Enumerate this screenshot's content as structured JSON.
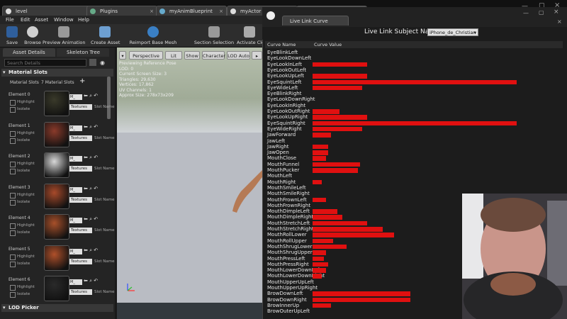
{
  "tabs": [
    {
      "label": "level",
      "active": false
    },
    {
      "label": "Plugins",
      "active": false
    },
    {
      "label": "myAnimBlueprint",
      "active": false
    },
    {
      "label": "myActor",
      "active": false
    },
    {
      "label": "",
      "active": true
    }
  ],
  "menu": [
    "File",
    "Edit",
    "Asset",
    "Window",
    "Help"
  ],
  "toolbar": {
    "save": "Save",
    "browse": "Browse",
    "preview_animation": "Preview Animation",
    "create_asset": "Create Asset",
    "reimport": "Reimport Base Mesh",
    "section_selection": "Section Selection",
    "activate_cloth": "Activate Clo"
  },
  "left_panel": {
    "tab_asset_details": "Asset Details",
    "tab_skeleton_tree": "Skeleton Tree",
    "search_placeholder": "Search Details",
    "material_slots_header": "Material Slots",
    "material_slots_label": "Material Slots",
    "material_slots_count": "7 Material Slots",
    "highlight": "Highlight",
    "isolate": "Isolate",
    "textures": "Textures",
    "slot_name": "Slot Name",
    "mat_short": "M_",
    "elements": [
      "Element 0",
      "Element 1",
      "Element 2",
      "Element 3",
      "Element 4",
      "Element 5",
      "Element 6"
    ],
    "lod_picker": "LOD Picker"
  },
  "viewport": {
    "perspective": "Perspective",
    "lit": "Lit",
    "show": "Show",
    "character": "Character",
    "lod_auto": "LOD Auto",
    "info": [
      "Previewing Reference Pose",
      "LOD: 0",
      "Current Screen Size: 3",
      "Triangles: 29,630",
      "Vertices: 17,862",
      "UV Channels: 1",
      "Approx Size: 278x73x209"
    ]
  },
  "live_link": {
    "tab_title": "Live Link Curve Debugger",
    "subject_label": "Live Link Subject Name:",
    "subject_value": "iPhone_de_Christian",
    "col_name": "Curve Name",
    "col_value": "Curve Value",
    "curves": [
      {
        "name": "EyeBlinkLeft",
        "value": 0
      },
      {
        "name": "EyeLookDownLeft",
        "value": 0
      },
      {
        "name": "EyeLookInLeft",
        "value": 0.24
      },
      {
        "name": "EyeLookOutLeft",
        "value": 0
      },
      {
        "name": "EyeLookUpLeft",
        "value": 0.24
      },
      {
        "name": "EyeSquintLeft",
        "value": 0.9
      },
      {
        "name": "EyeWideLeft",
        "value": 0.22
      },
      {
        "name": "EyeBlinkRight",
        "value": 0
      },
      {
        "name": "EyeLookDownRight",
        "value": 0
      },
      {
        "name": "EyeLookInRight",
        "value": 0
      },
      {
        "name": "EyeLookOutRight",
        "value": 0.12
      },
      {
        "name": "EyeLookUpRight",
        "value": 0.24
      },
      {
        "name": "EyeSquintRight",
        "value": 0.9
      },
      {
        "name": "EyeWideRight",
        "value": 0.22
      },
      {
        "name": "JawForward",
        "value": 0.08
      },
      {
        "name": "JawLeft",
        "value": 0
      },
      {
        "name": "JawRight",
        "value": 0.07
      },
      {
        "name": "JawOpen",
        "value": 0.07
      },
      {
        "name": "MouthClose",
        "value": 0.06
      },
      {
        "name": "MouthFunnel",
        "value": 0.21
      },
      {
        "name": "MouthPucker",
        "value": 0.2
      },
      {
        "name": "MouthLeft",
        "value": 0
      },
      {
        "name": "MouthRight",
        "value": 0.04
      },
      {
        "name": "MouthSmileLeft",
        "value": 0
      },
      {
        "name": "MouthSmileRight",
        "value": 0
      },
      {
        "name": "MouthFrownLeft",
        "value": 0.06
      },
      {
        "name": "MouthFrownRight",
        "value": 0
      },
      {
        "name": "MouthDimpleLeft",
        "value": 0.11
      },
      {
        "name": "MouthDimpleRight",
        "value": 0.13
      },
      {
        "name": "MouthStretchLeft",
        "value": 0.24
      },
      {
        "name": "MouthStretchRight",
        "value": 0.31
      },
      {
        "name": "MouthRollLower",
        "value": 0.36
      },
      {
        "name": "MouthRollUpper",
        "value": 0.09
      },
      {
        "name": "MouthShrugLower",
        "value": 0.15
      },
      {
        "name": "MouthShrugUpper",
        "value": 0.06
      },
      {
        "name": "MouthPressLeft",
        "value": 0.05
      },
      {
        "name": "MouthPressRight",
        "value": 0.07
      },
      {
        "name": "MouthLowerDownLeft",
        "value": 0.06
      },
      {
        "name": "MouthLowerDownRight",
        "value": 0.04
      },
      {
        "name": "MouthUpperUpLeft",
        "value": 0
      },
      {
        "name": "MouthUpperUpRight",
        "value": 0
      },
      {
        "name": "BrowDownLeft",
        "value": 0.43
      },
      {
        "name": "BrowDownRight",
        "value": 0.43
      },
      {
        "name": "BrowInnerUp",
        "value": 0.08
      },
      {
        "name": "BrowOuterUpLeft",
        "value": 0
      }
    ]
  },
  "colors": {
    "bar": "#e01010",
    "panel_bg": "#1c1c1c"
  }
}
